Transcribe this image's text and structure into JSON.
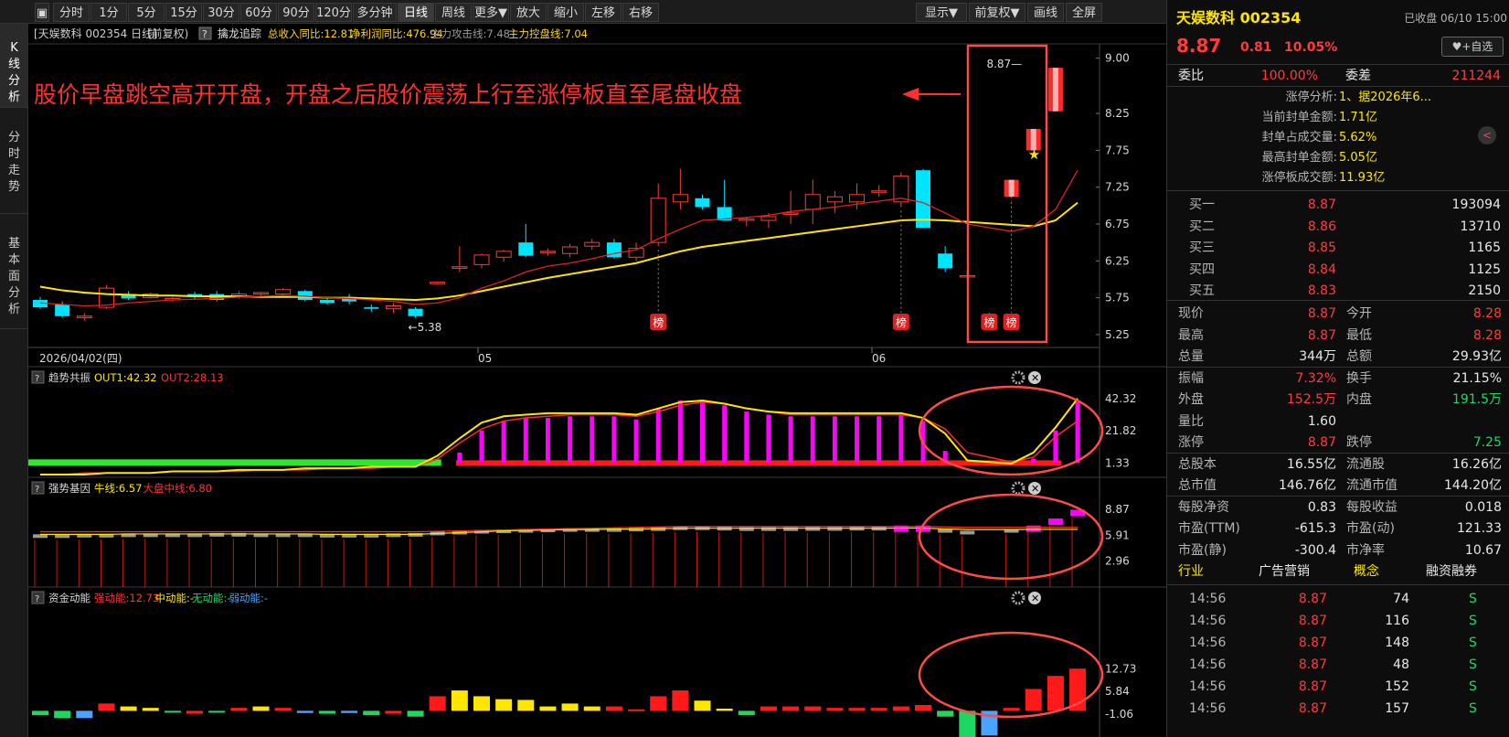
{
  "toolbar": {
    "items": [
      {
        "label": "分时",
        "active": false
      },
      {
        "label": "1分",
        "active": false
      },
      {
        "label": "5分",
        "active": false
      },
      {
        "label": "15分",
        "active": false
      },
      {
        "label": "30分",
        "active": false
      },
      {
        "label": "60分",
        "active": false
      },
      {
        "label": "90分",
        "active": false
      },
      {
        "label": "120分",
        "active": false
      },
      {
        "label": "多分钟",
        "active": false
      },
      {
        "label": "日线",
        "active": true
      },
      {
        "label": "周线",
        "active": false
      },
      {
        "label": "更多▼",
        "active": false
      },
      {
        "label": "放大",
        "active": false
      },
      {
        "label": "缩小",
        "active": false
      },
      {
        "label": "左移",
        "active": false
      },
      {
        "label": "右移",
        "active": false
      }
    ],
    "right": [
      {
        "label": "显示▼"
      },
      {
        "label": "前复权▼"
      },
      {
        "label": "画线"
      },
      {
        "label": "全屏"
      }
    ]
  },
  "side_tabs": [
    {
      "label": "K线分析",
      "active": true
    },
    {
      "label": "分时走势",
      "active": false
    },
    {
      "label": "基本面分析",
      "active": false
    }
  ],
  "main_header": {
    "stock": "[天娱数科 002354 日线]",
    "adjust": "(前复权)",
    "help": "?",
    "indicator": "擒龙追踪",
    "fields": [
      {
        "text": "总收入同比:12.81",
        "color": "#ffd21e"
      },
      {
        "text": "净利润同比:476.94",
        "color": "#ffd21e"
      },
      {
        "text": "主力攻击线:7.48",
        "color": "#9a9a9a"
      },
      {
        "text": "主力控盘线:7.04",
        "color": "#ffd21e"
      }
    ]
  },
  "annotation": "股价早盘跳空高开开盘，开盘之后股价震荡上行至涨停板直至尾盘收盘",
  "last_price_label": "8.87",
  "low_label": "5.38",
  "bang_label": "榜",
  "x_axis": {
    "start": "2026/04/02(四)",
    "ticks": [
      "05",
      "06"
    ]
  },
  "panels": [
    {
      "name": "趋势共振",
      "fields": [
        {
          "text": "OUT1:42.32",
          "color": "#ffe600"
        },
        {
          "text": "OUT2:28.13",
          "color": "#ff3333"
        }
      ],
      "ticks": [
        "42.32",
        "21.82",
        "1.33"
      ]
    },
    {
      "name": "强势基因",
      "fields": [
        {
          "text": "牛线:6.57",
          "color": "#ffe600"
        },
        {
          "text": "大盘中线:6.80",
          "color": "#ff3333"
        }
      ],
      "ticks": [
        "8.87",
        "5.91",
        "2.96"
      ]
    },
    {
      "name": "资金动能",
      "fields": [
        {
          "text": "强动能:12.73",
          "color": "#ff3333"
        },
        {
          "text": "中动能:-",
          "color": "#ffe600"
        },
        {
          "text": "无动能:-",
          "color": "#1ed760"
        },
        {
          "text": "弱动能:-",
          "color": "#4aa3ff"
        }
      ],
      "ticks": [
        "12.73",
        "5.84",
        "-1.06"
      ]
    }
  ],
  "chart_data": {
    "type": "candlestick",
    "title": "天娱数科 002354 日线",
    "yticks": [
      "9.00",
      "8.25",
      "7.75",
      "7.25",
      "6.75",
      "6.25",
      "5.75",
      "5.25"
    ],
    "ylim": [
      5.1,
      9.12
    ],
    "candles": [
      {
        "o": 5.72,
        "h": 5.76,
        "l": 5.6,
        "c": 5.62
      },
      {
        "o": 5.66,
        "h": 5.7,
        "l": 5.48,
        "c": 5.5
      },
      {
        "o": 5.48,
        "h": 5.54,
        "l": 5.44,
        "c": 5.5
      },
      {
        "o": 5.62,
        "h": 5.92,
        "l": 5.6,
        "c": 5.88
      },
      {
        "o": 5.8,
        "h": 5.84,
        "l": 5.72,
        "c": 5.74
      },
      {
        "o": 5.75,
        "h": 5.82,
        "l": 5.74,
        "c": 5.8
      },
      {
        "o": 5.72,
        "h": 5.76,
        "l": 5.7,
        "c": 5.74
      },
      {
        "o": 5.8,
        "h": 5.83,
        "l": 5.72,
        "c": 5.76
      },
      {
        "o": 5.8,
        "h": 5.84,
        "l": 5.7,
        "c": 5.72
      },
      {
        "o": 5.76,
        "h": 5.84,
        "l": 5.74,
        "c": 5.8
      },
      {
        "o": 5.8,
        "h": 5.83,
        "l": 5.78,
        "c": 5.82
      },
      {
        "o": 5.8,
        "h": 5.88,
        "l": 5.78,
        "c": 5.86
      },
      {
        "o": 5.84,
        "h": 5.86,
        "l": 5.7,
        "c": 5.72
      },
      {
        "o": 5.72,
        "h": 5.75,
        "l": 5.66,
        "c": 5.68
      },
      {
        "o": 5.76,
        "h": 5.8,
        "l": 5.66,
        "c": 5.7
      },
      {
        "o": 5.62,
        "h": 5.66,
        "l": 5.56,
        "c": 5.6
      },
      {
        "o": 5.6,
        "h": 5.68,
        "l": 5.54,
        "c": 5.64
      },
      {
        "o": 5.6,
        "h": 5.62,
        "l": 5.48,
        "c": 5.5
      },
      {
        "o": 5.95,
        "h": 5.97,
        "l": 5.93,
        "c": 5.96
      },
      {
        "o": 6.15,
        "h": 6.45,
        "l": 6.1,
        "c": 6.17
      },
      {
        "o": 6.2,
        "h": 6.35,
        "l": 6.15,
        "c": 6.33
      },
      {
        "o": 6.3,
        "h": 6.4,
        "l": 6.24,
        "c": 6.38
      },
      {
        "o": 6.5,
        "h": 6.75,
        "l": 6.3,
        "c": 6.32
      },
      {
        "o": 6.38,
        "h": 6.42,
        "l": 6.32,
        "c": 6.38
      },
      {
        "o": 6.35,
        "h": 6.48,
        "l": 6.3,
        "c": 6.44
      },
      {
        "o": 6.45,
        "h": 6.55,
        "l": 6.4,
        "c": 6.5
      },
      {
        "o": 6.5,
        "h": 6.55,
        "l": 6.28,
        "c": 6.3
      },
      {
        "o": 6.3,
        "h": 6.5,
        "l": 6.25,
        "c": 6.42
      },
      {
        "o": 6.5,
        "h": 7.3,
        "l": 6.45,
        "c": 7.1
      },
      {
        "o": 7.05,
        "h": 7.5,
        "l": 6.95,
        "c": 7.15
      },
      {
        "o": 7.1,
        "h": 7.15,
        "l": 6.95,
        "c": 6.98
      },
      {
        "o": 6.98,
        "h": 7.35,
        "l": 6.8,
        "c": 6.8
      },
      {
        "o": 6.8,
        "h": 6.85,
        "l": 6.72,
        "c": 6.82
      },
      {
        "o": 6.8,
        "h": 6.9,
        "l": 6.7,
        "c": 6.85
      },
      {
        "o": 6.9,
        "h": 7.2,
        "l": 6.75,
        "c": 6.9
      },
      {
        "o": 6.95,
        "h": 7.35,
        "l": 6.75,
        "c": 7.15
      },
      {
        "o": 7.05,
        "h": 7.2,
        "l": 6.9,
        "c": 7.12
      },
      {
        "o": 7.05,
        "h": 7.3,
        "l": 6.95,
        "c": 7.15
      },
      {
        "o": 7.2,
        "h": 7.28,
        "l": 7.12,
        "c": 7.2
      },
      {
        "o": 7.05,
        "h": 7.45,
        "l": 6.98,
        "c": 7.4
      },
      {
        "o": 7.48,
        "h": 7.5,
        "l": 6.7,
        "c": 6.7
      },
      {
        "o": 6.35,
        "h": 6.45,
        "l": 6.1,
        "c": 6.15
      },
      {
        "o": 6.05,
        "h": 6.1,
        "l": 6.0,
        "c": 6.05
      },
      null,
      {
        "o": 7.12,
        "h": 7.35,
        "l": 7.1,
        "c": 7.35
      },
      {
        "o": 7.75,
        "h": 8.04,
        "l": 7.75,
        "c": 8.04
      },
      {
        "o": 8.28,
        "h": 8.87,
        "l": 8.28,
        "c": 8.87
      }
    ],
    "ma_short": [
      5.68,
      5.66,
      5.64,
      5.65,
      5.68,
      5.7,
      5.72,
      5.73,
      5.74,
      5.76,
      5.77,
      5.78,
      5.77,
      5.75,
      5.74,
      5.72,
      5.7,
      5.66,
      5.68,
      5.75,
      5.88,
      5.98,
      6.1,
      6.18,
      6.22,
      6.28,
      6.35,
      6.4,
      6.55,
      6.68,
      6.8,
      6.82,
      6.84,
      6.87,
      6.92,
      6.95,
      6.98,
      7.02,
      7.06,
      7.1,
      7.04,
      6.9,
      6.75,
      6.65,
      6.72,
      6.95,
      7.48
    ],
    "ma_long": [
      5.9,
      5.85,
      5.82,
      5.8,
      5.79,
      5.78,
      5.78,
      5.77,
      5.77,
      5.77,
      5.76,
      5.76,
      5.76,
      5.75,
      5.75,
      5.74,
      5.73,
      5.72,
      5.74,
      5.78,
      5.84,
      5.9,
      5.96,
      6.02,
      6.07,
      6.12,
      6.17,
      6.22,
      6.3,
      6.38,
      6.44,
      6.48,
      6.52,
      6.56,
      6.6,
      6.64,
      6.68,
      6.72,
      6.76,
      6.8,
      6.81,
      6.8,
      6.78,
      6.74,
      6.72,
      6.8,
      7.04
    ],
    "bang_at": [
      28,
      39,
      43,
      44
    ]
  },
  "trend_data": {
    "ylim": [
      -6,
      48
    ],
    "bars": [
      0,
      0,
      0,
      0,
      0,
      0,
      0,
      0,
      0,
      0,
      0,
      0,
      0,
      0,
      0,
      0,
      0,
      0,
      0,
      8,
      22,
      28,
      30,
      30,
      31,
      31,
      31,
      29,
      36,
      41,
      41,
      38,
      34,
      32,
      31,
      31,
      31,
      31,
      31,
      32,
      28,
      9,
      0,
      0,
      4,
      22,
      40
    ],
    "green_band_to": 18,
    "red_band_from": 19,
    "out1": [
      -6,
      -6,
      -6,
      -5,
      -5,
      -5,
      -4,
      -4,
      -4,
      -3,
      -3,
      -3,
      -2,
      -2,
      -2,
      -1,
      -1,
      -1,
      6,
      17,
      27,
      31,
      32,
      33,
      33,
      33,
      33,
      32,
      36,
      40,
      41,
      39,
      36,
      34,
      33,
      33,
      33,
      33,
      33,
      33,
      30,
      20,
      3,
      1,
      8,
      24,
      42.32
    ],
    "out2": [
      -6,
      -6,
      -5,
      -5,
      -5,
      -5,
      -4,
      -4,
      -4,
      -4,
      -3,
      -3,
      -3,
      -2,
      -2,
      -2,
      -1,
      -1,
      4,
      14,
      23,
      28,
      30,
      31,
      32,
      32,
      32,
      31,
      34,
      38,
      40,
      39,
      36,
      34,
      32,
      32,
      32,
      32,
      32,
      32,
      30,
      23,
      8,
      2,
      5,
      18,
      28.13
    ]
  },
  "gene_data": {
    "ylim": [
      0,
      10
    ],
    "bars": [
      5.8,
      5.8,
      5.85,
      5.85,
      5.9,
      5.9,
      5.9,
      5.9,
      5.95,
      5.95,
      5.9,
      5.9,
      5.9,
      5.85,
      5.85,
      5.85,
      5.9,
      5.95,
      6.1,
      6.2,
      6.3,
      6.35,
      6.4,
      6.45,
      6.5,
      6.5,
      6.5,
      6.55,
      6.6,
      6.7,
      6.7,
      6.65,
      6.6,
      6.6,
      6.6,
      6.62,
      6.62,
      6.65,
      6.65,
      6.8,
      6.8,
      6.4,
      6.2,
      6.4,
      6.8,
      7.6,
      8.6
    ],
    "bar_colors": [
      "#9a9a9a",
      "#9a9a9a",
      "#9a9a9a",
      "#9a9a9a",
      "#9a9a9a",
      "#9a9a9a",
      "#9a9a9a",
      "#9a9a9a",
      "#9a9a9a",
      "#9a9a9a",
      "#9a9a9a",
      "#9a9a9a",
      "#9a9a9a",
      "#9a9a9a",
      "#9a9a9a",
      "#9a9a9a",
      "#9a9a9a",
      "#9a9a9a",
      "#9a9a9a",
      "#9a9a9a",
      "#9a9a9a",
      "#9a9a9a",
      "#9a9a9a",
      "#9a9a9a",
      "#9a9a9a",
      "#9a9a9a",
      "#9a9a9a",
      "#9a9a9a",
      "#9a9a9a",
      "#9a9a9a",
      "#9a9a9a",
      "#9a9a9a",
      "#9a9a9a",
      "#9a9a9a",
      "#9a9a9a",
      "#9a9a9a",
      "#9a9a9a",
      "#9a9a9a",
      "#9a9a9a",
      "#ff00ff",
      "#ff00ff",
      "#9a9a9a",
      "#9a9a9a",
      "#9a9a9a",
      "#ff00ff",
      "#ff00ff",
      "#ff00ff"
    ],
    "line1": [
      6.0,
      6.0,
      6.0,
      6.0,
      6.05,
      6.05,
      6.05,
      6.05,
      6.05,
      6.05,
      6.05,
      6.05,
      6.05,
      6.0,
      6.0,
      6.0,
      6.0,
      6.0,
      6.1,
      6.2,
      6.3,
      6.4,
      6.45,
      6.5,
      6.55,
      6.55,
      6.6,
      6.6,
      6.65,
      6.7,
      6.7,
      6.7,
      6.7,
      6.7,
      6.7,
      6.7,
      6.7,
      6.7,
      6.7,
      6.72,
      6.72,
      6.62,
      6.55,
      6.55,
      6.57,
      6.57,
      6.57
    ],
    "line2": [
      6.3,
      6.3,
      6.3,
      6.3,
      6.3,
      6.3,
      6.3,
      6.3,
      6.3,
      6.3,
      6.3,
      6.3,
      6.3,
      6.3,
      6.3,
      6.3,
      6.3,
      6.3,
      6.35,
      6.4,
      6.45,
      6.5,
      6.55,
      6.6,
      6.65,
      6.7,
      6.75,
      6.8,
      6.85,
      6.9,
      6.9,
      6.9,
      6.9,
      6.9,
      6.9,
      6.9,
      6.9,
      6.9,
      6.9,
      6.9,
      6.9,
      6.85,
      6.8,
      6.8,
      6.8,
      6.8,
      6.8
    ]
  },
  "energy_data": {
    "ylim": [
      -3.6,
      14
    ],
    "bars": [
      -0.6,
      -1.0,
      -1.0,
      1.0,
      0.6,
      0.4,
      -0.2,
      -0.4,
      -0.2,
      0.4,
      0.6,
      0.4,
      -0.3,
      -0.4,
      -0.3,
      -0.6,
      -0.4,
      -0.8,
      2.0,
      2.8,
      2.0,
      1.6,
      1.5,
      0.6,
      1.0,
      0.6,
      0.6,
      0.2,
      2.0,
      2.8,
      1.4,
      0.3,
      -0.6,
      0.6,
      0.6,
      0.6,
      0.4,
      0.4,
      0.4,
      0.6,
      0.8,
      -0.8,
      -3.6,
      -3.4,
      0.4,
      3.0,
      4.8,
      5.8
    ],
    "colors": [
      "#1ed760",
      "#1ed760",
      "#4aa3ff",
      "#ff1a1a",
      "#ffe600",
      "#ffe600",
      "#1ed760",
      "#ff1a1a",
      "#1ed760",
      "#ff1a1a",
      "#ffe600",
      "#ff1a1a",
      "#4aa3ff",
      "#1ed760",
      "#4aa3ff",
      "#1ed760",
      "#ff1a1a",
      "#1ed760",
      "#ff1a1a",
      "#ffe600",
      "#ffe600",
      "#ffe600",
      "#ffe600",
      "#ffe600",
      "#ffe600",
      "#ffe600",
      "#ff1a1a",
      "#ff1a1a",
      "#ff1a1a",
      "#ff1a1a",
      "#ffe600",
      "#ffe600",
      "#1ed760",
      "#ff1a1a",
      "#ff1a1a",
      "#ff1a1a",
      "#ff1a1a",
      "#ff1a1a",
      "#ff1a1a",
      "#ff1a1a",
      "#ff1a1a",
      "#1ed760",
      "#1ed760",
      "#4aa3ff",
      "#ff1a1a",
      "#ff1a1a",
      "#ff1a1a",
      "#ff1a1a"
    ]
  },
  "right_panel": {
    "title": "天娱数科 002354",
    "status": "已收盘 06/10 15:00",
    "price": "8.87",
    "change": "0.81",
    "pct": "10.05%",
    "watch_btn": "+自选",
    "weibi_label": "委比",
    "weibi": "100.00%",
    "weicha_label": "委差",
    "weicha": "211244",
    "limit_info": [
      {
        "k": "涨停分析:",
        "v": "1、据2026年6..."
      },
      {
        "k": "当前封单金额:",
        "v": "1.71亿"
      },
      {
        "k": "封单占成交量:",
        "v": "5.62%"
      },
      {
        "k": "最高封单金额:",
        "v": "5.05亿"
      },
      {
        "k": "涨停板成交额:",
        "v": "11.93亿"
      }
    ],
    "buys": [
      {
        "k": "买一",
        "p": "8.87",
        "v": "193094"
      },
      {
        "k": "买二",
        "p": "8.86",
        "v": "13710"
      },
      {
        "k": "买三",
        "p": "8.85",
        "v": "1165"
      },
      {
        "k": "买四",
        "p": "8.84",
        "v": "1125"
      },
      {
        "k": "买五",
        "p": "8.83",
        "v": "2150"
      }
    ],
    "quote": [
      {
        "k1": "现价",
        "v1": "8.87",
        "c1": "red",
        "k2": "今开",
        "v2": "8.28",
        "c2": "red"
      },
      {
        "k1": "最高",
        "v1": "8.87",
        "c1": "red",
        "k2": "最低",
        "v2": "8.28",
        "c2": "red"
      },
      {
        "k1": "总量",
        "v1": "344万",
        "c1": "wht",
        "k2": "总额",
        "v2": "29.93亿",
        "c2": "wht"
      },
      {
        "k1": "振幅",
        "v1": "7.32%",
        "c1": "red",
        "k2": "换手",
        "v2": "21.15%",
        "c2": "wht"
      },
      {
        "k1": "外盘",
        "v1": "152.5万",
        "c1": "red",
        "k2": "内盘",
        "v2": "191.5万",
        "c2": "grn"
      },
      {
        "k1": "量比",
        "v1": "1.60",
        "c1": "wht",
        "k2": "",
        "v2": "",
        "c2": "wht"
      },
      {
        "k1": "涨停",
        "v1": "8.87",
        "c1": "red",
        "k2": "跌停",
        "v2": "7.25",
        "c2": "grn"
      },
      {
        "k1": "总股本",
        "v1": "16.55亿",
        "c1": "wht",
        "k2": "流通股",
        "v2": "16.26亿",
        "c2": "wht"
      },
      {
        "k1": "总市值",
        "v1": "146.76亿",
        "c1": "wht",
        "k2": "流通市值",
        "v2": "144.20亿",
        "c2": "wht"
      },
      {
        "k1": "每股净资",
        "v1": "0.83",
        "c1": "wht",
        "k2": "每股收益",
        "v2": "0.018",
        "c2": "wht"
      },
      {
        "k1": "市盈(TTM)",
        "v1": "-615.3",
        "c1": "wht",
        "k2": "市盈(动)",
        "v2": "121.33",
        "c2": "wht"
      },
      {
        "k1": "市盈(静)",
        "v1": "-300.4",
        "c1": "wht",
        "k2": "市净率",
        "v2": "10.67",
        "c2": "wht"
      }
    ],
    "industry": {
      "k1": "行业",
      "v1": "广告营销",
      "k2": "概念",
      "v2": "融资融券"
    },
    "ticks": [
      {
        "t": "14:56",
        "p": "8.87",
        "v": "74",
        "s": "S"
      },
      {
        "t": "14:56",
        "p": "8.87",
        "v": "116",
        "s": "S"
      },
      {
        "t": "14:56",
        "p": "8.87",
        "v": "148",
        "s": "S"
      },
      {
        "t": "14:56",
        "p": "8.87",
        "v": "48",
        "s": "S"
      },
      {
        "t": "14:56",
        "p": "8.87",
        "v": "152",
        "s": "S"
      },
      {
        "t": "14:56",
        "p": "8.87",
        "v": "157",
        "s": "S"
      }
    ]
  }
}
